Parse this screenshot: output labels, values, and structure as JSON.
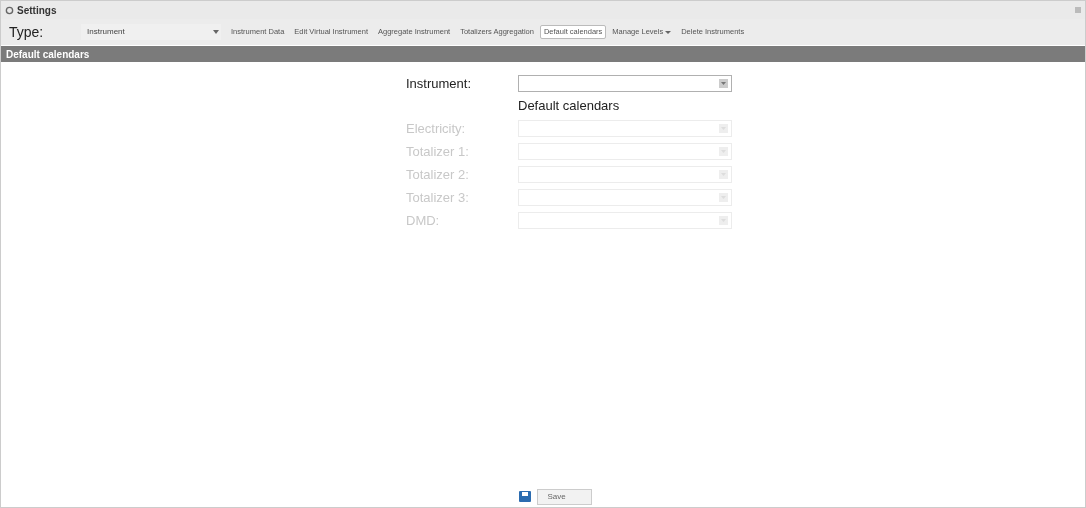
{
  "window": {
    "title": "Settings"
  },
  "type_field": {
    "label": "Type:",
    "value": "Instrument"
  },
  "tabs": [
    {
      "label": "Instrument Data",
      "selected": false,
      "dropdown": false
    },
    {
      "label": "Edit Virtual Instrument",
      "selected": false,
      "dropdown": false
    },
    {
      "label": "Aggregate Instrument",
      "selected": false,
      "dropdown": false
    },
    {
      "label": "Totalizers Aggregation",
      "selected": false,
      "dropdown": false
    },
    {
      "label": "Default calendars",
      "selected": true,
      "dropdown": false
    },
    {
      "label": "Manage Levels",
      "selected": false,
      "dropdown": true
    },
    {
      "label": "Delete Instruments",
      "selected": false,
      "dropdown": false
    }
  ],
  "panel": {
    "title": "Default calendars",
    "instrument": {
      "label": "Instrument:",
      "disabled": false
    },
    "section_title": "Default calendars",
    "fields": [
      {
        "label": "Electricity:",
        "disabled": true
      },
      {
        "label": "Totalizer 1:",
        "disabled": true
      },
      {
        "label": "Totalizer 2:",
        "disabled": true
      },
      {
        "label": "Totalizer 3:",
        "disabled": true
      },
      {
        "label": "DMD:",
        "disabled": true
      }
    ]
  },
  "save_button": {
    "label": "Save"
  }
}
